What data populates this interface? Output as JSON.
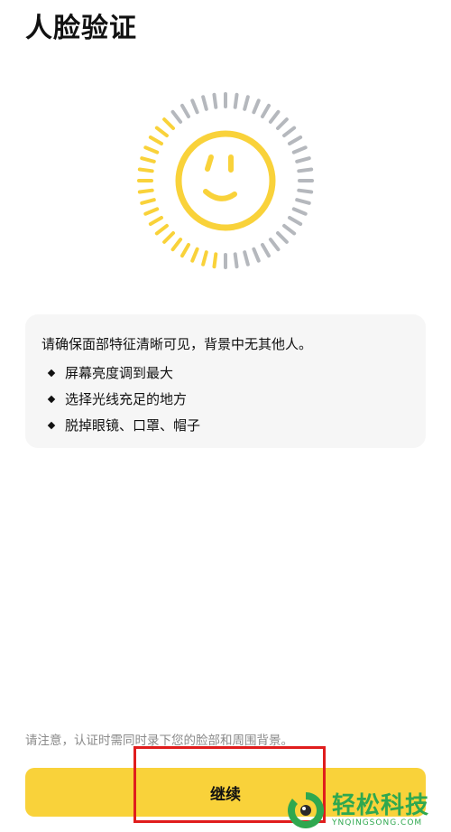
{
  "header": {
    "title": "人脸验证"
  },
  "face": {
    "icon": "smiley-face-icon",
    "yellow": "#f9d23a",
    "gray": "#b5b8bd"
  },
  "info": {
    "main": "请确保面部特征清晰可见，背景中无其他人。",
    "tips": [
      "屏幕亮度调到最大",
      "选择光线充足的地方",
      "脱掉眼镜、口罩、帽子"
    ]
  },
  "notice": "请注意，认证时需同时录下您的脸部和周围背景。",
  "button": {
    "label": "继续",
    "color": "#f9d23a"
  },
  "watermark": {
    "text": "轻松科技",
    "sub": "YNQINGSONG.COM"
  },
  "annotation": {
    "color": "#e01d1d"
  }
}
